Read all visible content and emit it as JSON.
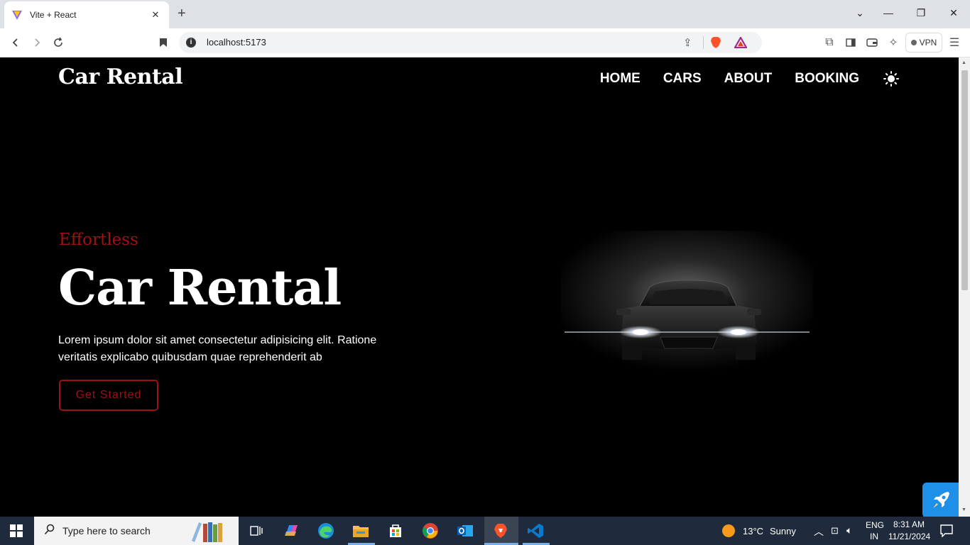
{
  "browser": {
    "tab_title": "Vite + React",
    "url": "localhost:5173",
    "vpn_label": "VPN"
  },
  "site": {
    "brand": "Car Rental",
    "nav": [
      "HOME",
      "CARS",
      "ABOUT",
      "BOOKING"
    ],
    "theme_icon": "sun-icon",
    "accent_color": "#a01014"
  },
  "hero": {
    "eyebrow": "Effortless",
    "title": "Car Rental",
    "description": "Lorem ipsum dolor sit amet consectetur adipisicing elit. Ratione veritatis explicabo quibusdam quae reprehenderit ab",
    "cta_label": "Get Started"
  },
  "taskbar": {
    "search_placeholder": "Type here to search",
    "weather_temp": "13°C",
    "weather_desc": "Sunny",
    "lang_top": "ENG",
    "lang_bottom": "IN",
    "time": "8:31 AM",
    "date": "11/21/2024"
  }
}
